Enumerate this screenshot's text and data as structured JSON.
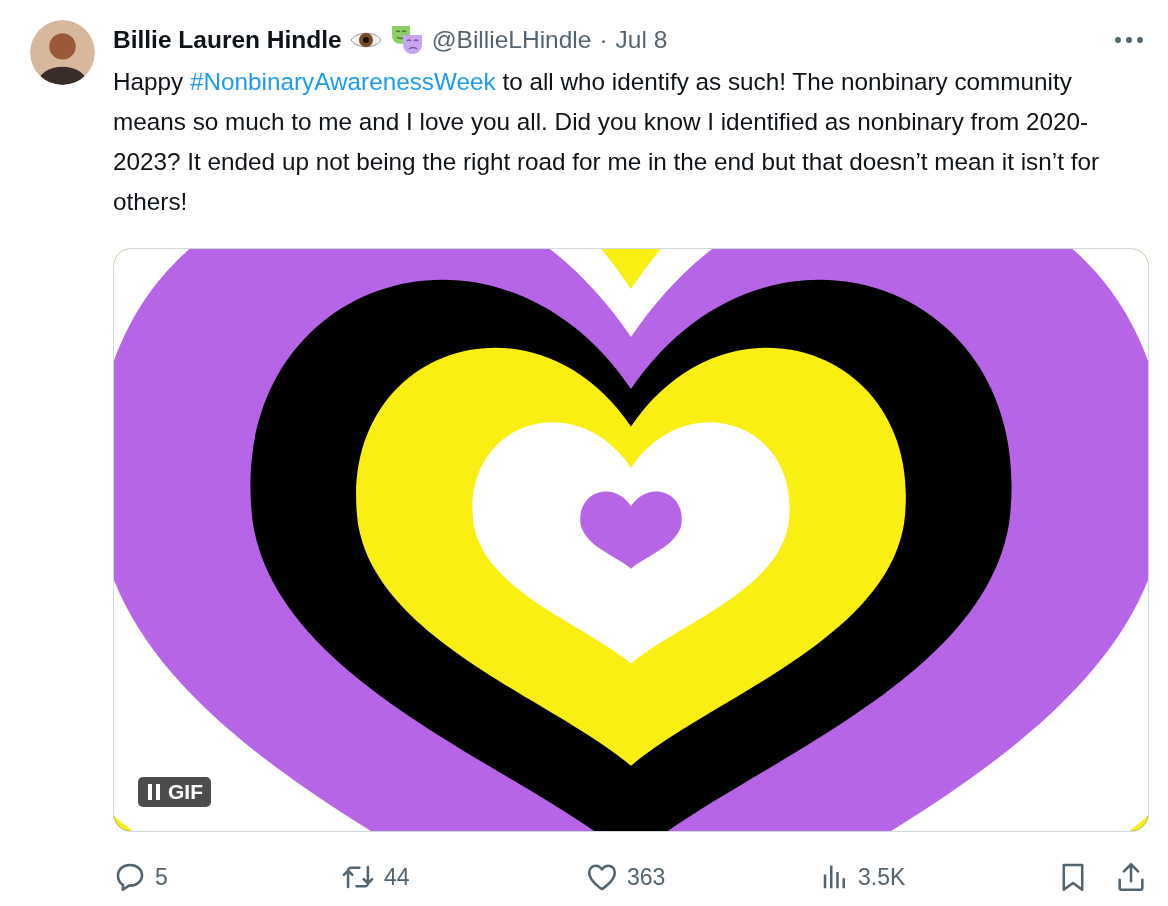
{
  "author": {
    "name": "Billie Lauren Hindle",
    "handle": "@BillieLHindle",
    "separator": "·",
    "date": "Jul 8"
  },
  "text": [
    {
      "kind": "text",
      "value": "Happy "
    },
    {
      "kind": "hashtag",
      "value": "#NonbinaryAwarenessWeek"
    },
    {
      "kind": "text",
      "value": " to all who identify as such! The nonbinary community means so much to me and I love you all. Did you know I identified as nonbinary from 2020-2023? It ended up not being the right road for me in the end but that doesn’t mean it isn’t for others!"
    }
  ],
  "media": {
    "kind": "picture",
    "badge": "GIF"
  },
  "actions": [
    {
      "kind": "reply",
      "count": "5"
    },
    {
      "kind": "retweet",
      "count": "44"
    },
    {
      "kind": "like",
      "count": "363"
    },
    {
      "kind": "views",
      "count": "3.5K"
    },
    {
      "kind": "bookmark"
    },
    {
      "kind": "share"
    }
  ]
}
